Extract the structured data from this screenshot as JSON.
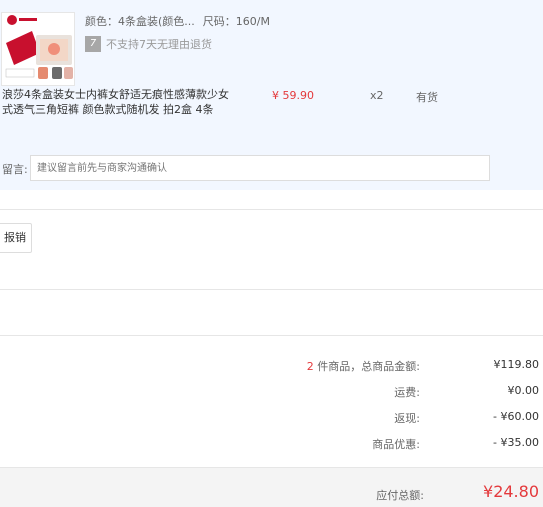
{
  "product": {
    "thumbnail_icon": "product-image-icon",
    "spec_color": "颜色：4条盒装(颜色...",
    "spec_size": "尺码：160/M",
    "return_badge": "7",
    "return_note": "不支持7天无理由退货",
    "title": "浪莎4条盒装女士内裤女舒适无痕性感薄款少女式透气三角短裤 颜色款式随机发 拍2盒 4条",
    "price": "¥ 59.90",
    "quantity": "x2",
    "stock": "有货"
  },
  "message": {
    "label": "留言:",
    "placeholder": "建议留言前先与商家沟通确认"
  },
  "invoice": {
    "button_label": "报销"
  },
  "summary": {
    "count": "2",
    "count_suffix": " 件商品，总商品金额:",
    "total_goods_value": "¥119.80",
    "shipping_label": "运费:",
    "shipping_value": "¥0.00",
    "rebate_label": "返现:",
    "rebate_value": "- ¥60.00",
    "discount_label": "商品优惠:",
    "discount_value": "- ¥35.00",
    "payable_label": "应付总额:",
    "payable_value": "¥24.80"
  },
  "colors": {
    "accent_red": "#e4393c",
    "product_bg": "#f2f7ff"
  }
}
